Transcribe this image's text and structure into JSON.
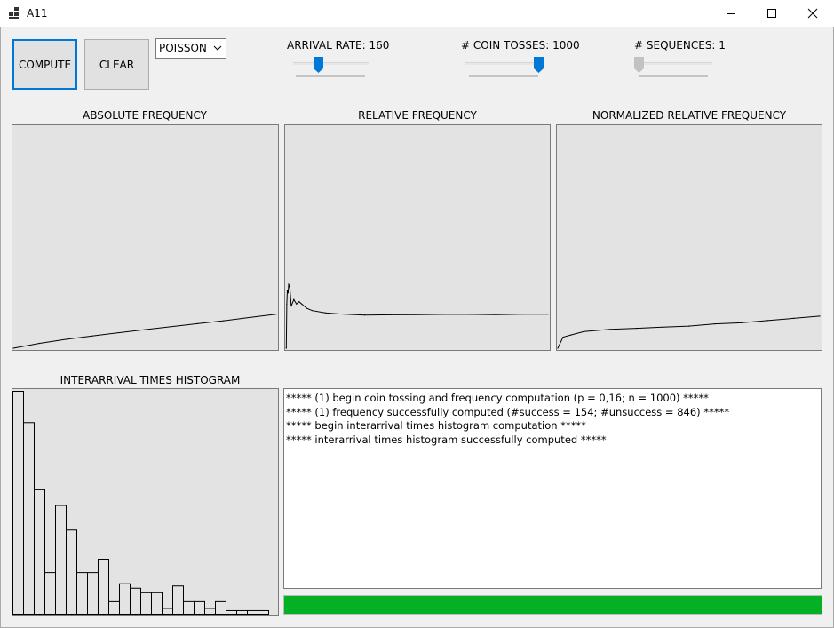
{
  "window": {
    "title": "A11"
  },
  "titlebar_icons": [
    "app-icon",
    "minimize-icon",
    "maximize-icon",
    "close-icon"
  ],
  "toolbar": {
    "compute_label": "COMPUTE",
    "clear_label": "CLEAR",
    "distribution": {
      "selected": "POISSON"
    }
  },
  "sliders": {
    "arrival_rate": {
      "label": "ARRIVAL RATE: 160",
      "value": 160,
      "level": 0.3
    },
    "coin_tosses": {
      "label": "# COIN TOSSES: 1000",
      "value": 1000,
      "level": 1.0
    },
    "sequences": {
      "label": "# SEQUENCES: 1",
      "value": 1,
      "level": 0.0
    }
  },
  "panels": {
    "absolute_title": "ABSOLUTE FREQUENCY",
    "relative_title": "RELATIVE FREQUENCY",
    "normalized_title": "NORMALIZED RELATIVE FREQUENCY",
    "histogram_title": "INTERARRIVAL TIMES HISTOGRAM"
  },
  "chart_data": [
    {
      "type": "line",
      "title": "ABSOLUTE FREQUENCY",
      "xlim": [
        0,
        1000
      ],
      "ylim": [
        0,
        1000
      ],
      "x": [
        0,
        100,
        200,
        300,
        400,
        500,
        600,
        700,
        800,
        900,
        1000
      ],
      "y": [
        0,
        22,
        40,
        55,
        70,
        84,
        97,
        111,
        124,
        139,
        154
      ]
    },
    {
      "type": "line",
      "title": "RELATIVE FREQUENCY",
      "xlim": [
        0,
        1000
      ],
      "ylim": [
        0,
        1
      ],
      "x": [
        1,
        3,
        5,
        8,
        10,
        15,
        20,
        30,
        40,
        50,
        60,
        80,
        100,
        150,
        200,
        300,
        400,
        500,
        600,
        700,
        800,
        900,
        1000
      ],
      "y": [
        0.0,
        0.2,
        0.26,
        0.25,
        0.29,
        0.27,
        0.19,
        0.22,
        0.2,
        0.21,
        0.2,
        0.18,
        0.17,
        0.16,
        0.155,
        0.15,
        0.151,
        0.152,
        0.153,
        0.153,
        0.152,
        0.154,
        0.154
      ]
    },
    {
      "type": "line",
      "title": "NORMALIZED RELATIVE FREQUENCY",
      "xlim": [
        0,
        1000
      ],
      "ylim": [
        0,
        1
      ],
      "x": [
        0,
        20,
        50,
        100,
        200,
        300,
        400,
        500,
        600,
        700,
        800,
        900,
        1000
      ],
      "y": [
        0.0,
        0.05,
        0.06,
        0.075,
        0.085,
        0.09,
        0.095,
        0.1,
        0.11,
        0.115,
        0.125,
        0.135,
        0.145
      ]
    },
    {
      "type": "bar",
      "title": "INTERARRIVAL TIMES HISTOGRAM",
      "ylim": [
        0,
        1
      ],
      "values": [
        1.0,
        0.86,
        0.56,
        0.19,
        0.49,
        0.38,
        0.19,
        0.19,
        0.25,
        0.06,
        0.14,
        0.12,
        0.1,
        0.1,
        0.03,
        0.13,
        0.06,
        0.06,
        0.03,
        0.06,
        0.02,
        0.02,
        0.02,
        0.02
      ]
    }
  ],
  "log": {
    "lines": [
      "***** (1) begin coin tossing and frequency computation (p = 0,16; n = 1000) *****",
      "***** (1) frequency successfully computed (#success = 154; #unsuccess = 846) *****",
      "***** begin interarrival times histogram computation *****",
      "***** interarrival times histogram successfully computed *****"
    ]
  },
  "progress": {
    "value": 1.0
  }
}
